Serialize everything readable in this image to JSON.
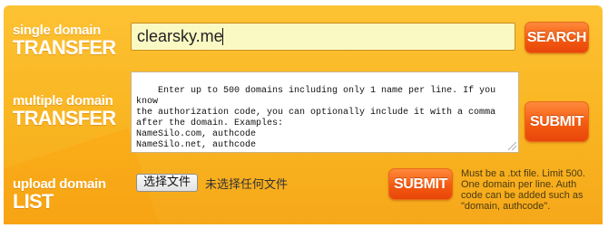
{
  "single": {
    "label_small": "single domain",
    "label_big": "TRANSFER",
    "input_value": "clearsky.me",
    "button_label": "SEARCH"
  },
  "multiple": {
    "label_small": "multiple domain",
    "label_big": "TRANSFER",
    "textarea_value": "Enter up to 500 domains including only 1 name per line. If you know\nthe authorization code, you can optionally include it with a comma\nafter the domain. Examples:\nNameSilo.com, authcode\nNameSilo.net, authcode",
    "button_label": "SUBMIT"
  },
  "upload": {
    "label_small": "upload domain",
    "label_big": "LIST",
    "file_button_label": "选择文件",
    "file_status": "未选择任何文件",
    "button_label": "SUBMIT",
    "note": "Must be a .txt file. Limit 500. One domain per line. Auth code can be added such as \"domain, authcode\"."
  },
  "colors": {
    "panel": "#fbb92a",
    "button": "#f35a10",
    "input_bg": "#fbf9c3"
  }
}
